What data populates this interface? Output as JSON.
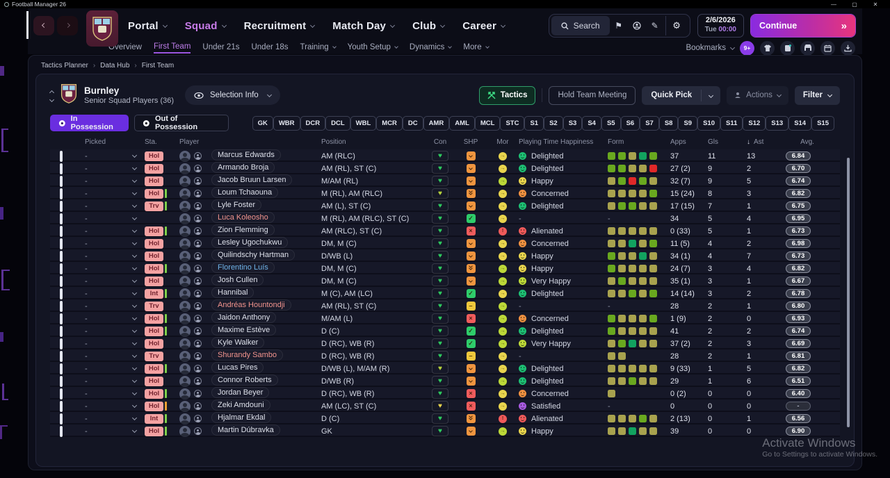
{
  "window": {
    "title": "Football Manager 26",
    "minimize": "—",
    "maximize": "▢",
    "close": "✕"
  },
  "nav": {
    "items": [
      {
        "label": "Portal",
        "active": false
      },
      {
        "label": "Squad",
        "active": true
      },
      {
        "label": "Recruitment",
        "active": false
      },
      {
        "label": "Match Day",
        "active": false
      },
      {
        "label": "Club",
        "active": false
      },
      {
        "label": "Career",
        "active": false
      }
    ],
    "subnav": [
      {
        "label": "Overview",
        "active": false,
        "caret": false
      },
      {
        "label": "First Team",
        "active": true,
        "caret": false
      },
      {
        "label": "Under 21s",
        "active": false,
        "caret": false
      },
      {
        "label": "Under 18s",
        "active": false,
        "caret": false
      },
      {
        "label": "Training",
        "active": false,
        "caret": true
      },
      {
        "label": "Youth Setup",
        "active": false,
        "caret": true
      },
      {
        "label": "Dynamics",
        "active": false,
        "caret": true
      },
      {
        "label": "More",
        "active": false,
        "caret": true
      }
    ],
    "search_label": "Search",
    "date": {
      "date": "2/6/2026",
      "day": "Tue",
      "time": "00:00"
    },
    "continue_label": "Continue",
    "continue_glyph": "»",
    "bookmarks_label": "Bookmarks",
    "notification_badge": "9+"
  },
  "breadcrumb": [
    "Tactics Planner",
    "Data Hub",
    "First Team"
  ],
  "team": {
    "name": "Burnley",
    "subtitle": "Senior Squad Players (36)",
    "selection_info_label": "Selection Info"
  },
  "toolbar": {
    "tactics_label": "Tactics",
    "meeting_label": "Hold Team Meeting",
    "quick_pick_label": "Quick Pick",
    "actions_label": "Actions",
    "filter_label": "Filter"
  },
  "tabs": [
    {
      "label": "In Possession",
      "active": true
    },
    {
      "label": "Out of Possession",
      "active": false
    }
  ],
  "position_chips": [
    "GK",
    "WBR",
    "DCR",
    "DCL",
    "WBL",
    "MCR",
    "DC",
    "AMR",
    "AML",
    "MCL",
    "STC",
    "S1",
    "S2",
    "S3",
    "S4",
    "S5",
    "S6",
    "S7",
    "S8",
    "S9",
    "S10",
    "S11",
    "S12",
    "S13",
    "S14",
    "S15"
  ],
  "table": {
    "headers": {
      "picked": "Picked",
      "sta": "Sta.",
      "player": "Player",
      "position": "Position",
      "con": "Con",
      "shp": "SHP",
      "mor": "Mor",
      "pth": "Playing Time Happiness",
      "form": "Form",
      "apps": "Apps",
      "gls": "Gls",
      "ast": "Ast",
      "avg": "Avg.",
      "sort_glyph": "↓"
    },
    "picked_placeholder": "-",
    "rows": [
      {
        "sta": "Hol",
        "bar": "",
        "name": "Marcus Edwards",
        "nc": "w",
        "pos": "AM (RLC)",
        "con": "green",
        "shp": "down",
        "mor": "yellow",
        "pth": "delighted",
        "pthl": "Delighted",
        "form": [
          "green",
          "green",
          "olive",
          "teal",
          "green"
        ],
        "apps": "37",
        "gls": "11",
        "ast": "13",
        "avg": "6.84"
      },
      {
        "sta": "Hol",
        "bar": "",
        "name": "Armando Broja",
        "nc": "w",
        "pos": "AM (RL), ST (C)",
        "con": "green",
        "shp": "down",
        "mor": "yellow",
        "pth": "delighted",
        "pthl": "Delighted",
        "form": [
          "green",
          "green",
          "olive",
          "olive",
          "red"
        ],
        "apps": "27 (2)",
        "gls": "9",
        "ast": "2",
        "avg": "6.70"
      },
      {
        "sta": "Hol",
        "bar": "",
        "name": "Jacob Bruun Larsen",
        "nc": "w",
        "pos": "M/AM (RL)",
        "con": "green",
        "shp": "down",
        "mor": "yellowgreen",
        "pth": "happy",
        "pthl": "Happy",
        "form": [
          "olive",
          "green",
          "red",
          "green",
          "olive"
        ],
        "apps": "32 (7)",
        "gls": "9",
        "ast": "5",
        "avg": "6.74"
      },
      {
        "sta": "Hol",
        "bar": "green",
        "name": "Loum Tchaouna",
        "nc": "w",
        "pos": "M (RL), AM (RLC)",
        "con": "yellowgreen",
        "shp": "down2",
        "mor": "yellow",
        "pth": "concerned",
        "pthl": "Concerned",
        "form": [
          "olive",
          "olive",
          "olive",
          "olive",
          "green"
        ],
        "apps": "15 (24)",
        "gls": "8",
        "ast": "3",
        "avg": "6.82"
      },
      {
        "sta": "Trv",
        "bar": "green",
        "name": "Lyle Foster",
        "nc": "w",
        "pos": "AM (L), ST (C)",
        "con": "green",
        "shp": "down",
        "mor": "yellow",
        "pth": "delighted",
        "pthl": "Delighted",
        "form": [
          "olive",
          "green",
          "green",
          "olive",
          "olive"
        ],
        "apps": "17 (15)",
        "gls": "7",
        "ast": "1",
        "avg": "6.75"
      },
      {
        "sta": "",
        "bar": "",
        "name": "Luca Koleosho",
        "nc": "pink",
        "pos": "M (RL), AM (RLC), ST (C)",
        "con": "green",
        "shp": "check",
        "mor": "yellow",
        "pth": "",
        "pthl": "-",
        "form": [],
        "apps": "34",
        "gls": "5",
        "ast": "4",
        "avg": "6.95"
      },
      {
        "sta": "Hol",
        "bar": "green",
        "name": "Zion Flemming",
        "nc": "w",
        "pos": "AM (RLC), ST (C)",
        "con": "green",
        "shp": "cross",
        "mor": "red",
        "pth": "alienated",
        "pthl": "Alienated",
        "form": [
          "olive",
          "olive",
          "olive",
          "olive",
          "olive"
        ],
        "apps": "0 (33)",
        "gls": "5",
        "ast": "1",
        "avg": "6.73"
      },
      {
        "sta": "Hol",
        "bar": "",
        "name": "Lesley Ugochukwu",
        "nc": "w",
        "pos": "DM, M (C)",
        "con": "green",
        "shp": "down",
        "mor": "yellow",
        "pth": "concerned",
        "pthl": "Concerned",
        "form": [
          "olive",
          "olive",
          "teal",
          "olive",
          "green"
        ],
        "apps": "11 (5)",
        "gls": "4",
        "ast": "2",
        "avg": "6.98"
      },
      {
        "sta": "Hol",
        "bar": "",
        "name": "Quilindschy Hartman",
        "nc": "w",
        "pos": "D/WB (L)",
        "con": "green",
        "shp": "down",
        "mor": "yellow",
        "pth": "happy",
        "pthl": "Happy",
        "form": [
          "green",
          "olive",
          "olive",
          "teal",
          "olive"
        ],
        "apps": "34 (1)",
        "gls": "4",
        "ast": "7",
        "avg": "6.73"
      },
      {
        "sta": "Hol",
        "bar": "green",
        "name": "Florentino Luís",
        "nc": "blue",
        "pos": "DM, M (C)",
        "con": "green",
        "shp": "down2",
        "mor": "yellowgreen",
        "pth": "happy",
        "pthl": "Happy",
        "form": [
          "green",
          "olive",
          "olive",
          "olive",
          "olive"
        ],
        "apps": "24 (7)",
        "gls": "3",
        "ast": "4",
        "avg": "6.82"
      },
      {
        "sta": "Hol",
        "bar": "",
        "name": "Josh Cullen",
        "nc": "w",
        "pos": "DM, M (C)",
        "con": "green",
        "shp": "down",
        "mor": "yellowgreen",
        "pth": "veryhappy",
        "pthl": "Very Happy",
        "form": [
          "olive",
          "green",
          "olive",
          "olive",
          "olive"
        ],
        "apps": "35 (1)",
        "gls": "3",
        "ast": "1",
        "avg": "6.67"
      },
      {
        "sta": "Int",
        "bar": "green",
        "name": "Hannibal",
        "nc": "w",
        "pos": "M (C), AM (LC)",
        "con": "green",
        "shp": "check",
        "mor": "yellow",
        "pth": "delighted",
        "pthl": "Delighted",
        "form": [
          "olive",
          "olive",
          "green",
          "olive",
          "green"
        ],
        "apps": "14 (14)",
        "gls": "3",
        "ast": "2",
        "avg": "6.78"
      },
      {
        "sta": "Trv",
        "bar": "",
        "name": "Andréas Hountondji",
        "nc": "pink",
        "pos": "AM (RL), ST (C)",
        "con": "green",
        "shp": "dash",
        "mor": "yellowgreen",
        "pth": "",
        "pthl": "-",
        "form": [],
        "apps": "28",
        "gls": "2",
        "ast": "1",
        "avg": "6.80"
      },
      {
        "sta": "Hol",
        "bar": "green",
        "name": "Jaidon Anthony",
        "nc": "w",
        "pos": "M/AM (L)",
        "con": "green",
        "shp": "cross",
        "mor": "yellowgreen",
        "pth": "concerned",
        "pthl": "Concerned",
        "form": [
          "green",
          "olive",
          "olive",
          "olive",
          "green"
        ],
        "apps": "1 (9)",
        "gls": "2",
        "ast": "0",
        "avg": "6.93"
      },
      {
        "sta": "Hol",
        "bar": "green",
        "name": "Maxime Estève",
        "nc": "w",
        "pos": "D (C)",
        "con": "green",
        "shp": "check",
        "mor": "yellowgreen",
        "pth": "delighted",
        "pthl": "Delighted",
        "form": [
          "green",
          "olive",
          "olive",
          "olive",
          "olive"
        ],
        "apps": "41",
        "gls": "2",
        "ast": "2",
        "avg": "6.74"
      },
      {
        "sta": "Hol",
        "bar": "",
        "name": "Kyle Walker",
        "nc": "w",
        "pos": "D (RC), WB (R)",
        "con": "green",
        "shp": "check",
        "mor": "yellowgreen",
        "pth": "veryhappy",
        "pthl": "Very Happy",
        "form": [
          "olive",
          "green",
          "teal",
          "olive",
          "olive"
        ],
        "apps": "37 (2)",
        "gls": "2",
        "ast": "3",
        "avg": "6.69"
      },
      {
        "sta": "Trv",
        "bar": "",
        "name": "Shurandy Sambo",
        "nc": "pink",
        "pos": "D (RC), WB (R)",
        "con": "green",
        "shp": "dash",
        "mor": "yellow",
        "pth": "",
        "pthl": "-",
        "form": [
          "olive",
          "olive"
        ],
        "apps": "28",
        "gls": "2",
        "ast": "1",
        "avg": "6.81"
      },
      {
        "sta": "Hol",
        "bar": "green",
        "name": "Lucas Pires",
        "nc": "w",
        "pos": "D/WB (L), M/AM (R)",
        "con": "yellowgreen",
        "shp": "down",
        "mor": "yellow",
        "pth": "delighted",
        "pthl": "Delighted",
        "form": [
          "olive",
          "olive",
          "olive",
          "olive",
          "olive"
        ],
        "apps": "9 (33)",
        "gls": "1",
        "ast": "5",
        "avg": "6.82"
      },
      {
        "sta": "Hol",
        "bar": "",
        "name": "Connor Roberts",
        "nc": "w",
        "pos": "D/WB (R)",
        "con": "green",
        "shp": "down",
        "mor": "yellowgreen",
        "pth": "delighted",
        "pthl": "Delighted",
        "form": [
          "olive",
          "olive",
          "green",
          "olive",
          "olive"
        ],
        "apps": "29",
        "gls": "1",
        "ast": "6",
        "avg": "6.51"
      },
      {
        "sta": "Hol",
        "bar": "green",
        "name": "Jordan Beyer",
        "nc": "w",
        "pos": "D (RC), WB (R)",
        "con": "green",
        "shp": "cross",
        "mor": "yellow",
        "pth": "concerned",
        "pthl": "Concerned",
        "form": [
          "olive"
        ],
        "apps": "0 (2)",
        "gls": "0",
        "ast": "0",
        "avg": "6.40"
      },
      {
        "sta": "Hol",
        "bar": "orange",
        "name": "Zeki Amdouni",
        "nc": "w",
        "pos": "AM (LC), ST (C)",
        "con": "yellow",
        "shp": "cross",
        "mor": "yellow",
        "pth": "satisfied",
        "pthl": "Satisfied",
        "form": [],
        "apps": "0",
        "gls": "0",
        "ast": "0",
        "avg": "-"
      },
      {
        "sta": "Int",
        "bar": "green",
        "name": "Hjalmar Ekdal",
        "nc": "w",
        "pos": "D (C)",
        "con": "green",
        "shp": "down2",
        "mor": "red",
        "pth": "alienated",
        "pthl": "Alienated",
        "form": [
          "olive",
          "olive",
          "olive",
          "green",
          "olive"
        ],
        "apps": "2 (13)",
        "gls": "0",
        "ast": "1",
        "avg": "6.56"
      },
      {
        "sta": "Hol",
        "bar": "green",
        "name": "Martin Dúbravka",
        "nc": "w",
        "pos": "GK",
        "con": "green",
        "shp": "down",
        "mor": "yellowgreen",
        "pth": "happy",
        "pthl": "Happy",
        "form": [
          "olive",
          "olive",
          "teal",
          "olive",
          "olive"
        ],
        "apps": "39",
        "gls": "0",
        "ast": "0",
        "avg": "6.90"
      }
    ]
  },
  "legend": {
    "form": {
      "olive": "#a8a24e",
      "green": "#69a81f",
      "teal": "#12a35f",
      "red": "#e02828"
    },
    "con": {
      "green": "#2ecc5e",
      "yellowgreen": "#b8d43c",
      "yellow": "#e8d44d"
    },
    "shp_bg": {
      "down": "#f0953f",
      "down2": "#f0953f",
      "check": "#2ecc6a",
      "cross": "#f05c5c",
      "dash": "#f0c83c"
    },
    "mor": {
      "yellow": "#e8d44d",
      "yellowgreen": "#bcd838",
      "red": "#f05a5a"
    },
    "pth": {
      "delighted": "#1dbf73",
      "happy": "#e8d44d",
      "veryhappy": "#bcd838",
      "concerned": "#f09040",
      "alienated": "#f05a5a",
      "satisfied": "#a85ae0"
    },
    "sta_bar": {
      "green": "#7ed04a",
      "orange": "#f0a030"
    },
    "name": {
      "w": "#dde0ea",
      "pink": "#f2948e",
      "blue": "#6fb3e8"
    },
    "accent_purple": "#6a2ee0",
    "accent_green": "#2f9e6a",
    "continue_gradient": [
      "#8a2be0",
      "#e8357d"
    ]
  },
  "icons": {
    "heart": "♥",
    "check": "✓",
    "cross": "×",
    "dash": "–",
    "mor_arrow": "→",
    "mor_alert": "!",
    "gear": "⚙",
    "pencil": "✎",
    "flag": "⚑",
    "sort_down": "↓"
  },
  "watermark": {
    "line1": "Activate Windows",
    "line2": "Go to Settings to activate Windows."
  }
}
